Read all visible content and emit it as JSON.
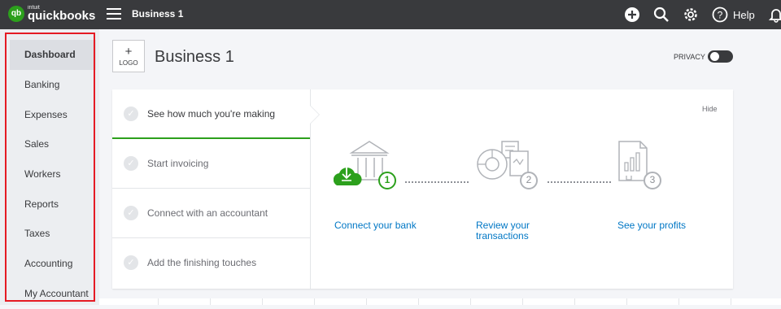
{
  "topbar": {
    "brand_intuit": "intuit",
    "brand_name": "quickbooks",
    "brand_badge": "qb",
    "company_name": "Business 1",
    "help_label": "Help"
  },
  "sidebar": {
    "items": [
      {
        "label": "Dashboard",
        "active": true
      },
      {
        "label": "Banking"
      },
      {
        "label": "Expenses"
      },
      {
        "label": "Sales"
      },
      {
        "label": "Workers"
      },
      {
        "label": "Reports"
      },
      {
        "label": "Taxes"
      },
      {
        "label": "Accounting"
      },
      {
        "label": "My Accountant"
      }
    ]
  },
  "header": {
    "logo_plus": "+",
    "logo_text": "LOGO",
    "business_title": "Business 1",
    "privacy_label": "PRIVACY"
  },
  "setup_card": {
    "hide_label": "Hide",
    "steps": [
      {
        "label": "See how much you're making",
        "active": true
      },
      {
        "label": "Start invoicing"
      },
      {
        "label": "Connect with an accountant"
      },
      {
        "label": "Add the finishing touches"
      }
    ],
    "flow": [
      {
        "number": "1",
        "link": "Connect your bank"
      },
      {
        "number": "2",
        "link_line1": "Review your",
        "link_line2": "transactions"
      },
      {
        "number": "3",
        "link": "See your profits"
      }
    ]
  },
  "colors": {
    "topbar": "#393a3d",
    "brand_green": "#2ca01c",
    "link_blue": "#0077c5",
    "highlight_red": "#e51b24"
  }
}
